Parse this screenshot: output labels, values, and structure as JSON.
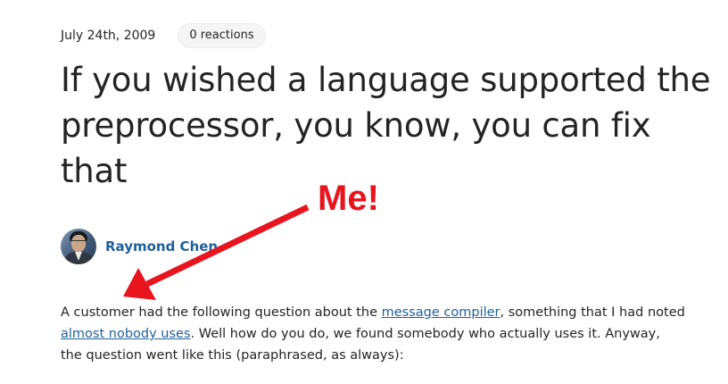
{
  "post": {
    "date": "July 24th, 2009",
    "reactions": "0 reactions",
    "title": "If you wished a language supported the preprocessor, you know, you can fix that",
    "author": "Raymond Chen"
  },
  "annotation": {
    "label": "Me!",
    "color": "#e8141e"
  },
  "body": {
    "part1": "A customer had the following question about the ",
    "link1": "message compiler",
    "part2": ", something that I had noted ",
    "link2": "almost nobody uses",
    "part3": ". Well how do you do, we found somebody who actually uses it. Anyway, the question went like this (paraphrased, as always):"
  },
  "colors": {
    "link": "#1f5f99",
    "text": "#242424",
    "pill_background": "#f5f5f5"
  }
}
